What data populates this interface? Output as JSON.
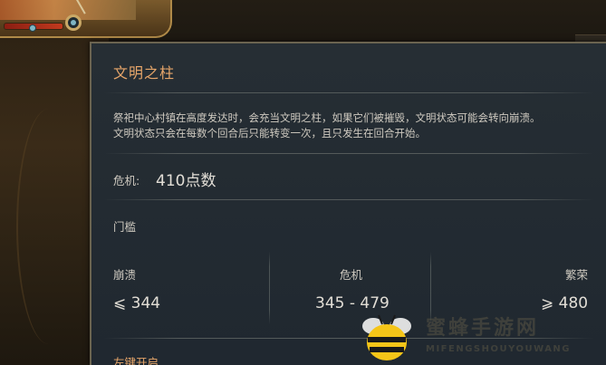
{
  "panel": {
    "title": "文明之柱",
    "description_line1": "祭祀中心村镇在高度发达时，会充当文明之柱，如果它们被摧毁，文明状态可能会转向崩溃。",
    "description_line2": "文明状态只会在每数个回合后只能转变一次，且只发生在回合开始。",
    "crisis_label": "危机:",
    "crisis_value": "410点数",
    "threshold_label": "门槛",
    "columns": [
      {
        "label": "崩溃",
        "value": "⩽ 344"
      },
      {
        "label": "危机",
        "value": "345 - 479"
      },
      {
        "label": "繁荣",
        "value": "⩾ 480"
      }
    ],
    "action_hint": "左键开启"
  },
  "watermark": {
    "text": "蜜蜂手游网",
    "subtext": "MIFENGSHOUYOUWANG"
  },
  "colors": {
    "accent": "#e7a66a",
    "panel_bg": "#232b31",
    "text": "#cfcac0"
  }
}
